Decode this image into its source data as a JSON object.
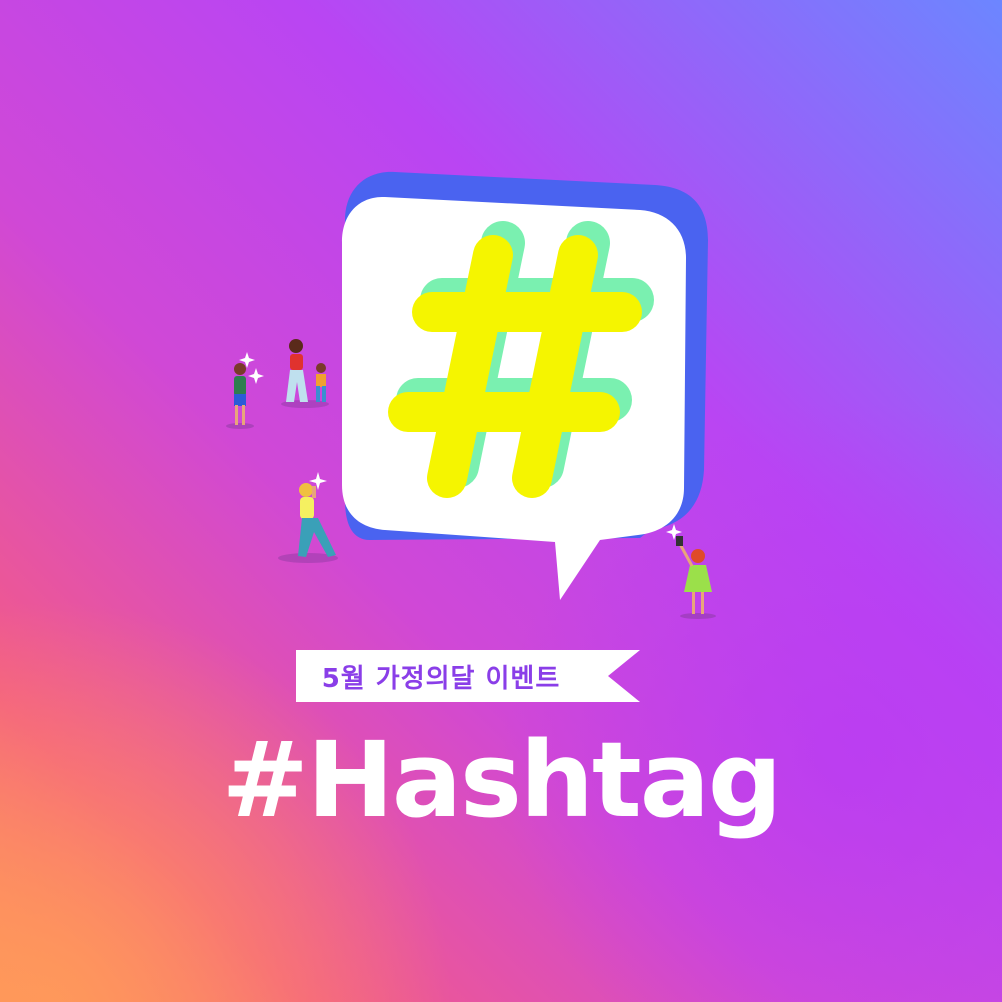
{
  "poster": {
    "ribbon_text": "5월 가정의달 이벤트",
    "headline": "#Hashtag"
  },
  "colors": {
    "bg_top_right": "#6a7cff",
    "bg_mid": "#c03ef0",
    "bg_bottom_left": "#ff8a5c",
    "bubble": "#ffffff",
    "bubble_shadow": "#4a63f0",
    "hash_fill": "#f5f500",
    "hash_shade": "#7af0b0",
    "ribbon_text": "#8a3ee8"
  },
  "icons": [
    "hashtag-icon",
    "sparkle-icon"
  ]
}
